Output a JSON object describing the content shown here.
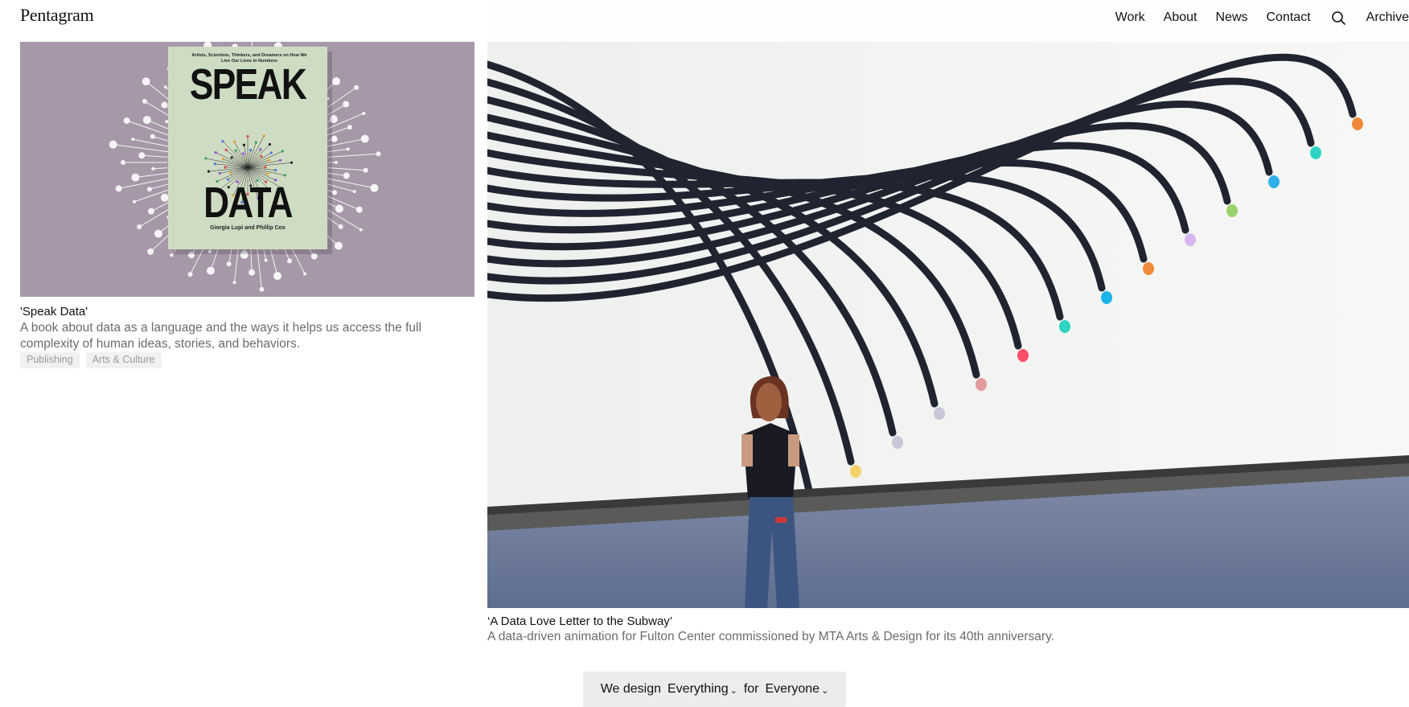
{
  "header": {
    "logo": "Pentagram",
    "nav": [
      {
        "label": "Work"
      },
      {
        "label": "About"
      },
      {
        "label": "News"
      },
      {
        "label": "Contact"
      }
    ],
    "search_icon": "search-icon",
    "archive_label": "Archive"
  },
  "cards": {
    "speak_data": {
      "cover_top": "Artists, Scientists, Thinkers, and Dreamers on How We Live Our Lives in Numbers",
      "cover_title_1": "SPEAK",
      "cover_title_2": "DATA",
      "cover_authors": "Giorgia Lupi and Phillip Cox",
      "title": "'Speak Data'",
      "description": "A book about data as a language and the ways it helps us access the full complexity of human ideas, stories, and behaviors.",
      "tags": [
        "Publishing",
        "Arts & Culture"
      ]
    },
    "subway": {
      "title": "‘A Data Love Letter to the Subway’",
      "description": "A data-driven animation for Fulton Center commissioned by MTA Arts & Design for its 40th anniversary."
    }
  },
  "filter": {
    "prefix": "We design",
    "what": "Everything",
    "middle": "for",
    "who": "Everyone"
  },
  "colors": {
    "speak_bg": "#a697a9",
    "book_cover": "#cfdcc4",
    "stripe": "#1f2430",
    "tag_bg": "#f1f1f1"
  }
}
